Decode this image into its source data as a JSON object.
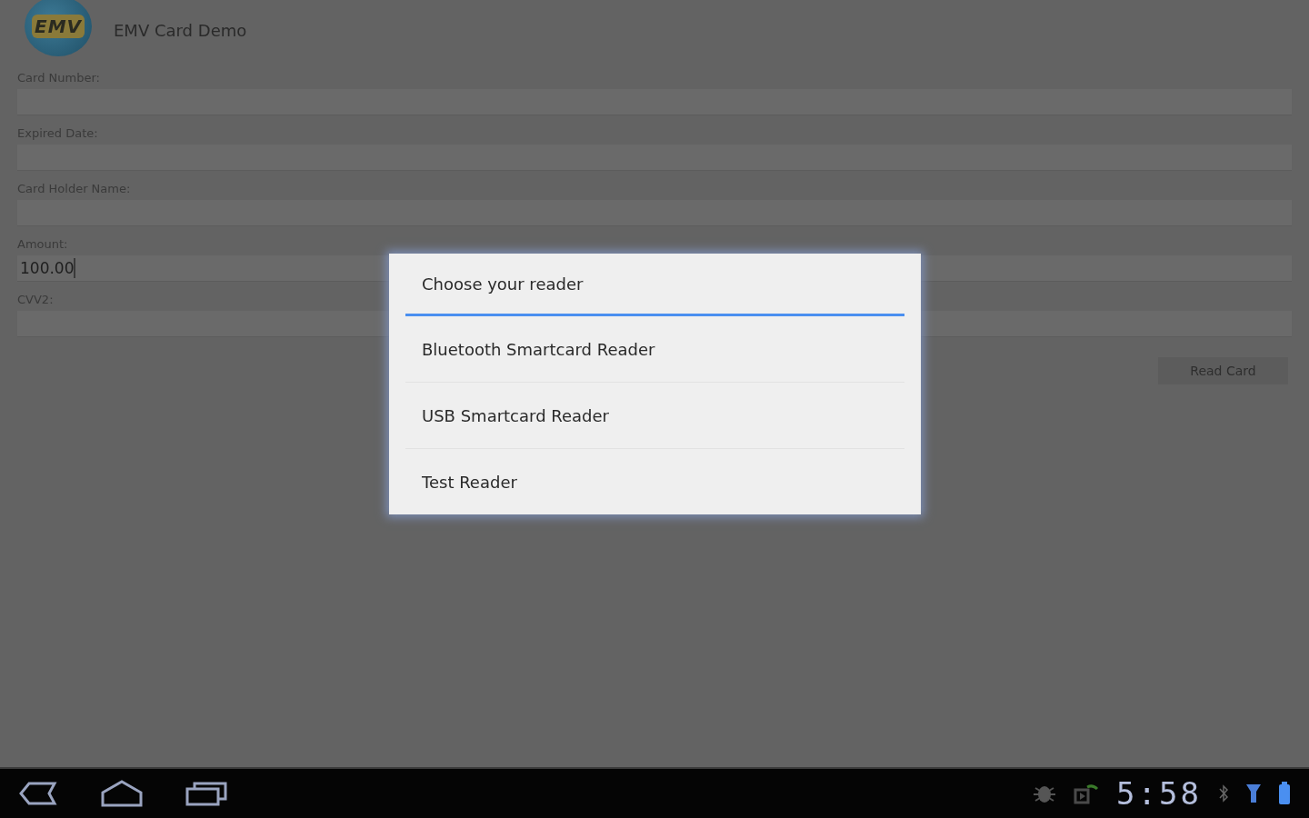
{
  "app": {
    "title": "EMV Card Demo",
    "logo": "EMV"
  },
  "fields": [
    {
      "label": "Card Number:"
    },
    {
      "label": "Expired Date:"
    },
    {
      "label": "Card Holder Name:"
    },
    {
      "label": "Amount:",
      "value": "100.00",
      "focused": true
    },
    {
      "label": "CVV2:"
    }
  ],
  "read_button": "Read Card",
  "dialog": {
    "title": "Choose your reader",
    "options": [
      "Bluetooth Smartcard Reader",
      "USB Smartcard Reader",
      "Test Reader"
    ]
  },
  "system_bar": {
    "time": "5:58"
  }
}
